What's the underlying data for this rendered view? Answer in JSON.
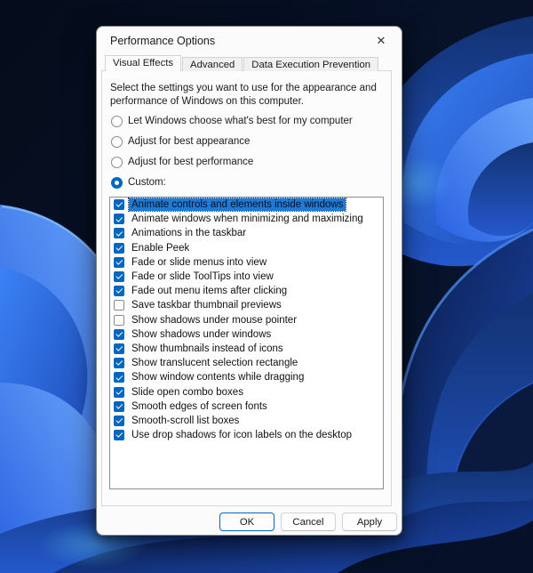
{
  "window": {
    "title": "Performance Options"
  },
  "icons": {
    "close": "✕"
  },
  "tabs": [
    {
      "label": "Visual Effects",
      "active": true
    },
    {
      "label": "Advanced",
      "active": false
    },
    {
      "label": "Data Execution Prevention",
      "active": false
    }
  ],
  "description": "Select the settings you want to use for the appearance and performance of Windows on this computer.",
  "radio_options": [
    {
      "label": "Let Windows choose what's best for my computer",
      "selected": false
    },
    {
      "label": "Adjust for best appearance",
      "selected": false
    },
    {
      "label": "Adjust for best performance",
      "selected": false
    },
    {
      "label": "Custom:",
      "selected": true
    }
  ],
  "visual_effects_list": [
    {
      "label": "Animate controls and elements inside windows",
      "checked": true,
      "selected": true
    },
    {
      "label": "Animate windows when minimizing and maximizing",
      "checked": true,
      "selected": false
    },
    {
      "label": "Animations in the taskbar",
      "checked": true,
      "selected": false
    },
    {
      "label": "Enable Peek",
      "checked": true,
      "selected": false
    },
    {
      "label": "Fade or slide menus into view",
      "checked": true,
      "selected": false
    },
    {
      "label": "Fade or slide ToolTips into view",
      "checked": true,
      "selected": false
    },
    {
      "label": "Fade out menu items after clicking",
      "checked": true,
      "selected": false
    },
    {
      "label": "Save taskbar thumbnail previews",
      "checked": false,
      "selected": false
    },
    {
      "label": "Show shadows under mouse pointer",
      "checked": false,
      "selected": false
    },
    {
      "label": "Show shadows under windows",
      "checked": true,
      "selected": false
    },
    {
      "label": "Show thumbnails instead of icons",
      "checked": true,
      "selected": false
    },
    {
      "label": "Show translucent selection rectangle",
      "checked": true,
      "selected": false
    },
    {
      "label": "Show window contents while dragging",
      "checked": true,
      "selected": false
    },
    {
      "label": "Slide open combo boxes",
      "checked": true,
      "selected": false
    },
    {
      "label": "Smooth edges of screen fonts",
      "checked": true,
      "selected": false
    },
    {
      "label": "Smooth-scroll list boxes",
      "checked": true,
      "selected": false
    },
    {
      "label": "Use drop shadows for icon labels on the desktop",
      "checked": true,
      "selected": false
    }
  ],
  "buttons": [
    {
      "label": "OK",
      "default": true
    },
    {
      "label": "Cancel",
      "default": false
    },
    {
      "label": "Apply",
      "default": false
    }
  ],
  "colors": {
    "accent": "#0067c0",
    "selection_bg": "#1e7ad4",
    "dialog_bg": "#fbfbfb",
    "wallpaper_dark": "#071022",
    "wallpaper_blue": "#2a62e2"
  }
}
